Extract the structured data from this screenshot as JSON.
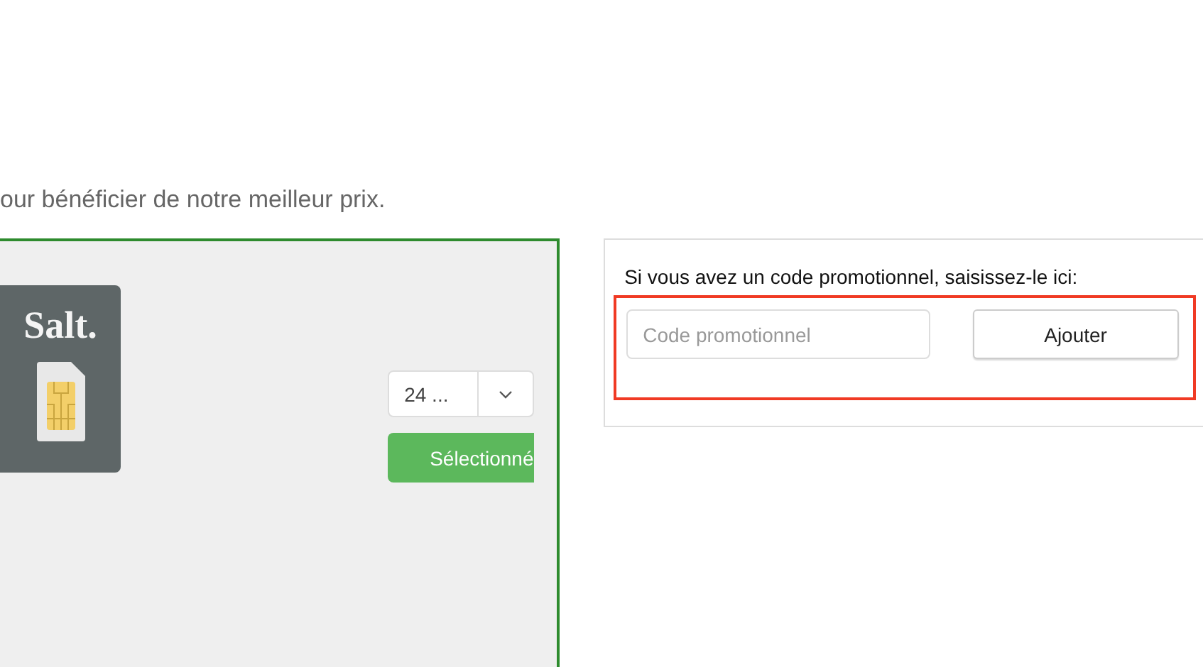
{
  "intro": "our bénéficier de notre meilleur prix.",
  "offer": {
    "logo": "Salt.",
    "duration": "24 ...",
    "select_button": "Sélectionné"
  },
  "promo": {
    "label": "Si vous avez un code promotionnel, saisissez-le ici:",
    "placeholder": "Code promotionnel",
    "button": "Ajouter"
  }
}
